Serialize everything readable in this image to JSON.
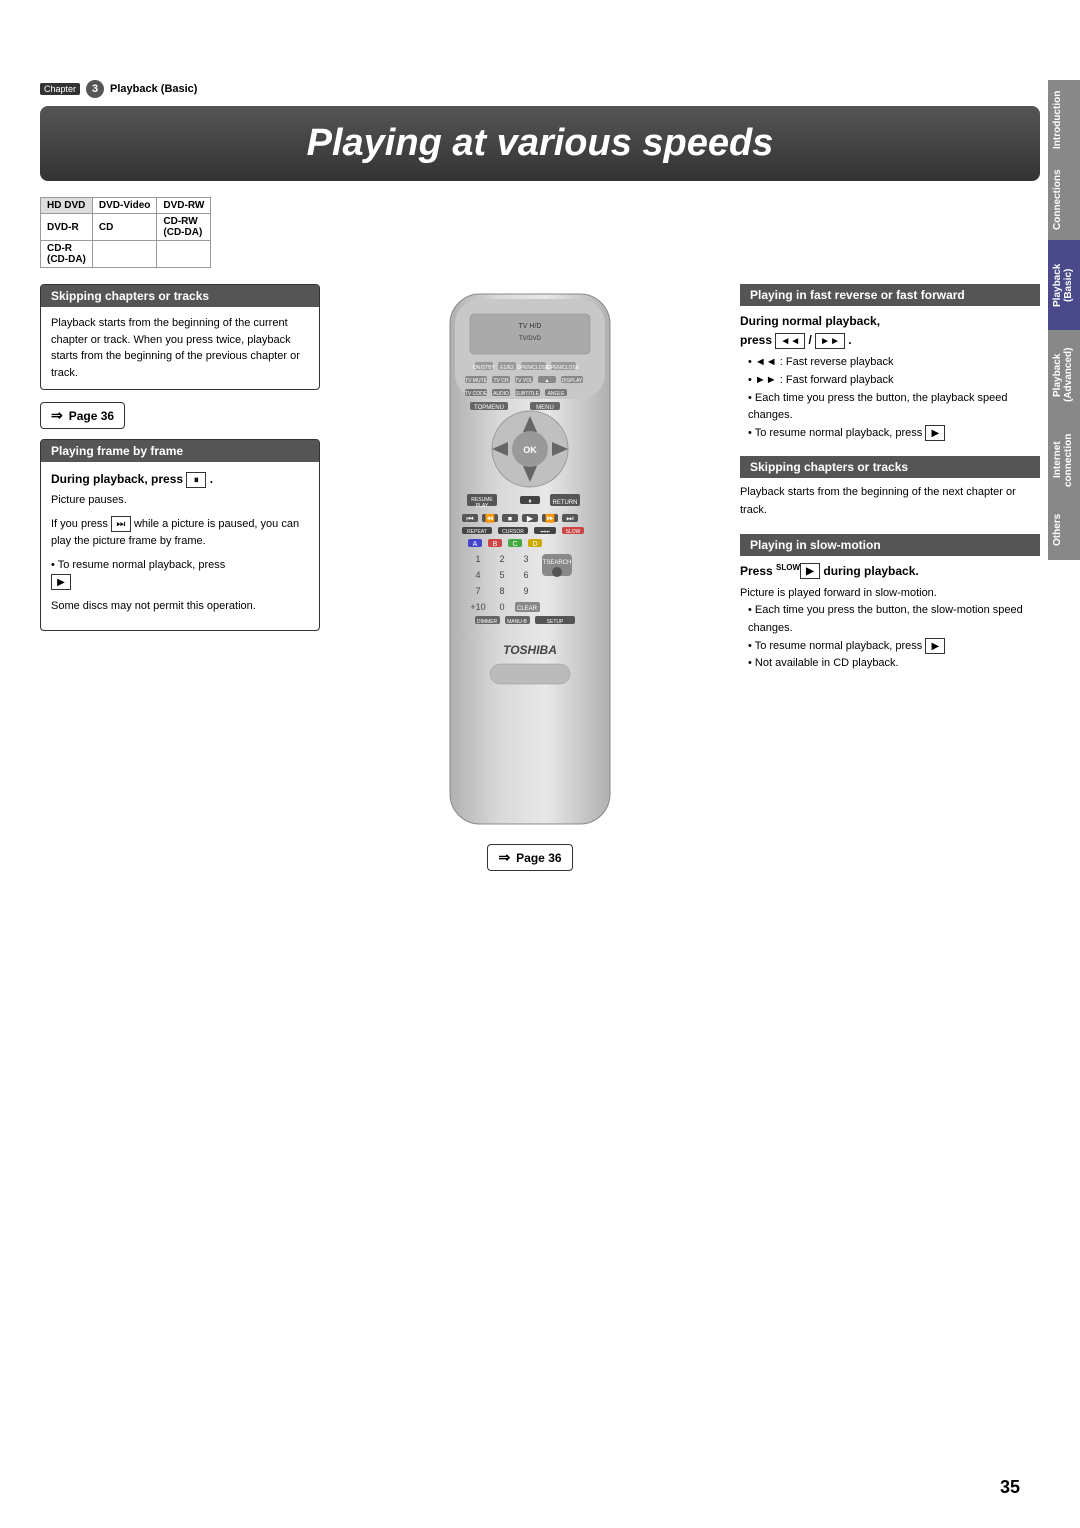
{
  "sidebar": {
    "tabs": [
      {
        "label": "Introduction",
        "class": "introduction"
      },
      {
        "label": "Connections",
        "class": "connections"
      },
      {
        "label": "Playback (Basic)",
        "class": "playback-basic"
      },
      {
        "label": "Playback (Advanced)",
        "class": "playback-advanced"
      },
      {
        "label": "Internet connection",
        "class": "internet"
      },
      {
        "label": "Others",
        "class": "others"
      }
    ]
  },
  "chapter": {
    "number": "3",
    "label": "Chapter",
    "title": "Playback (Basic)"
  },
  "page_title": "Playing at various speeds",
  "disc_table": {
    "rows": [
      [
        "HD DVD",
        "DVD-Video",
        "DVD-RW"
      ],
      [
        "DVD-R",
        "CD",
        "CD-RW (CD-DA)"
      ],
      [
        "CD-R (CD-DA)",
        "",
        ""
      ]
    ]
  },
  "left_column": {
    "skip_box": {
      "header": "Skipping chapters or tracks",
      "body": "Playback starts from the beginning of the current chapter or track. When you press twice, playback starts from the beginning of the previous chapter or track."
    },
    "page_ref_top": "Page 36",
    "frame_box": {
      "header": "Playing frame by frame",
      "subheader": "During playback, press",
      "body_lines": [
        "Picture pauses.",
        "If you press while a picture is paused, you can play the picture frame by frame.",
        "• To resume normal playback, press",
        "Some discs may not permit this operation."
      ]
    }
  },
  "right_column": {
    "fast_section": {
      "header": "Playing in fast reverse or fast forward",
      "bold_text": "During normal playback, press  /  .",
      "lines": [
        "◄◄ : Fast reverse playback",
        "►► : Fast forward playback",
        "• Each time you press the button, the playback speed changes.",
        "• To resume normal playback, press"
      ]
    },
    "skip_section": {
      "header": "Skipping chapters or tracks",
      "body": "Playback starts from the beginning of the next chapter or track."
    },
    "slow_section": {
      "header": "Playing in slow-motion",
      "bold_text": "Press  during playback.",
      "slow_label": "SLOW",
      "lines": [
        "Picture is played forward in slow-motion.",
        "• Each time you press the button, the slow-motion speed changes.",
        "• To resume normal playback, press",
        "• Not available in CD playback."
      ]
    }
  },
  "page_ref_bottom": "Page 36",
  "page_number": "35",
  "brand": "TOSHIBA"
}
